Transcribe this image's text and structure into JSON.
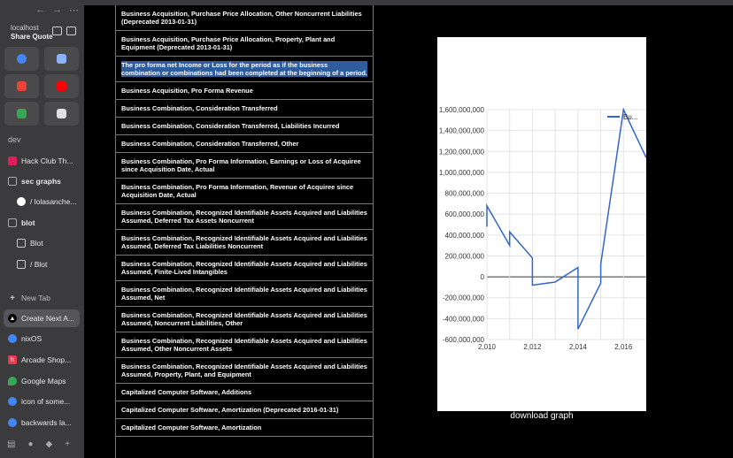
{
  "browser": {
    "host": "localhost",
    "tab_title": "Share Quote",
    "nav": {
      "back": "←",
      "forward": "→",
      "more": "⋯"
    }
  },
  "favorites": [
    {
      "name": "google",
      "color": "#4285f4"
    },
    {
      "name": "calculator",
      "color": "#8ab4f8"
    },
    {
      "name": "gmail",
      "color": "#ea4335"
    },
    {
      "name": "youtube",
      "color": "#ff0000"
    },
    {
      "name": "google-drive",
      "color": "#34a853"
    },
    {
      "name": "todo",
      "color": "#e0e0e0"
    }
  ],
  "sidebar": {
    "section_dev": "dev",
    "items": [
      {
        "label": "Hack Club Th...",
        "icon": "slack-icon",
        "color": "#e01e5a"
      },
      {
        "label": "sec graphs",
        "icon": "folder-icon",
        "color": "#aaaaaa",
        "bold": true
      },
      {
        "label": "/ lolasanche...",
        "icon": "github-icon",
        "color": "#ffffff"
      },
      {
        "label": "blot",
        "icon": "folder-icon",
        "color": "#aaaaaa",
        "bold": true
      },
      {
        "label": "Blot",
        "icon": "blot-icon",
        "color": "#cccccc"
      },
      {
        "label": "/ Blot",
        "icon": "blot-icon",
        "color": "#cccccc"
      }
    ],
    "new_tab": "New Tab",
    "tabs": [
      {
        "label": "Create Next A...",
        "icon": "vercel-icon",
        "color": "#000000",
        "active": true
      },
      {
        "label": "nixOS",
        "icon": "google-icon",
        "color": "#4285f4"
      },
      {
        "label": "Arcade Shop...",
        "icon": "hackclub-icon",
        "color": "#ec3750"
      },
      {
        "label": "Google Maps",
        "icon": "maps-icon",
        "color": "#34a853"
      },
      {
        "label": "icon of some...",
        "icon": "google-icon",
        "color": "#4285f4"
      },
      {
        "label": "backwards la...",
        "icon": "google-icon",
        "color": "#4285f4"
      }
    ]
  },
  "concepts": [
    "Business Acquisition, Purchase Price Allocation, Other Noncurrent Liabilities (Deprecated 2013-01-31)",
    "Business Acquisition, Purchase Price Allocation, Property, Plant and Equipment (Deprecated 2013-01-31)",
    "The pro forma net Income or Loss for the period as if the business combination or combinations had been completed at the beginning of a period.",
    "Business Acquisition, Pro Forma Revenue",
    "Business Combination, Consideration Transferred",
    "Business Combination, Consideration Transferred, Liabilities Incurred",
    "Business Combination, Consideration Transferred, Other",
    "Business Combination, Pro Forma Information, Earnings or Loss of Acquiree since Acquisition Date, Actual",
    "Business Combination, Pro Forma Information, Revenue of Acquiree since Acquisition Date, Actual",
    "Business Combination, Recognized Identifiable Assets Acquired and Liabilities Assumed, Deferred Tax Assets Noncurrent",
    "Business Combination, Recognized Identifiable Assets Acquired and Liabilities Assumed, Deferred Tax Liabilities Noncurrent",
    "Business Combination, Recognized Identifiable Assets Acquired and Liabilities Assumed, Finite-Lived Intangibles",
    "Business Combination, Recognized Identifiable Assets Acquired and Liabilities Assumed, Net",
    "Business Combination, Recognized Identifiable Assets Acquired and Liabilities Assumed, Noncurrent Liabilities, Other",
    "Business Combination, Recognized Identifiable Assets Acquired and Liabilities Assumed, Other Noncurrent Assets",
    "Business Combination, Recognized Identifiable Assets Acquired and Liabilities Assumed, Property, Plant, and Equipment",
    "Capitalized Computer Software, Additions",
    "Capitalized Computer Software, Amortization (Deprecated 2016-01-31)",
    "Capitalized Computer Software, Amortization"
  ],
  "highlighted_index": 2,
  "download_label": "download graph",
  "chart_data": {
    "type": "line",
    "legend": "Bu...",
    "legend_position": "top-right",
    "line_color": "#3366cc",
    "grid": true,
    "xlim": [
      2010,
      2017
    ],
    "ylim": [
      -600000000,
      1600000000
    ],
    "x_ticks": [
      2010,
      2012,
      2014,
      2016
    ],
    "x_tick_labels": [
      "2,010",
      "2,012",
      "2,014",
      "2,016"
    ],
    "y_ticks": [
      -600000000,
      -400000000,
      -200000000,
      0,
      200000000,
      400000000,
      600000000,
      800000000,
      1000000000,
      1200000000,
      1400000000,
      1600000000
    ],
    "y_tick_labels": [
      "-600,000,000",
      "-400,000,000",
      "-200,000,000",
      "0",
      "200,000,000",
      "400,000,000",
      "600,000,000",
      "800,000,000",
      "1,000,000,000",
      "1,200,000,000",
      "1,400,000,000",
      "1,600,000,000"
    ],
    "points": [
      [
        2010.0,
        480000000
      ],
      [
        2010.0,
        680000000
      ],
      [
        2011.0,
        300000000
      ],
      [
        2011.0,
        430000000
      ],
      [
        2012.0,
        180000000
      ],
      [
        2012.0,
        -80000000
      ],
      [
        2013.0,
        -50000000
      ],
      [
        2014.0,
        90000000
      ],
      [
        2014.0,
        -500000000
      ],
      [
        2015.0,
        -60000000
      ],
      [
        2015.0,
        120000000
      ],
      [
        2016.0,
        1600000000
      ],
      [
        2017.0,
        1140000000
      ]
    ]
  }
}
